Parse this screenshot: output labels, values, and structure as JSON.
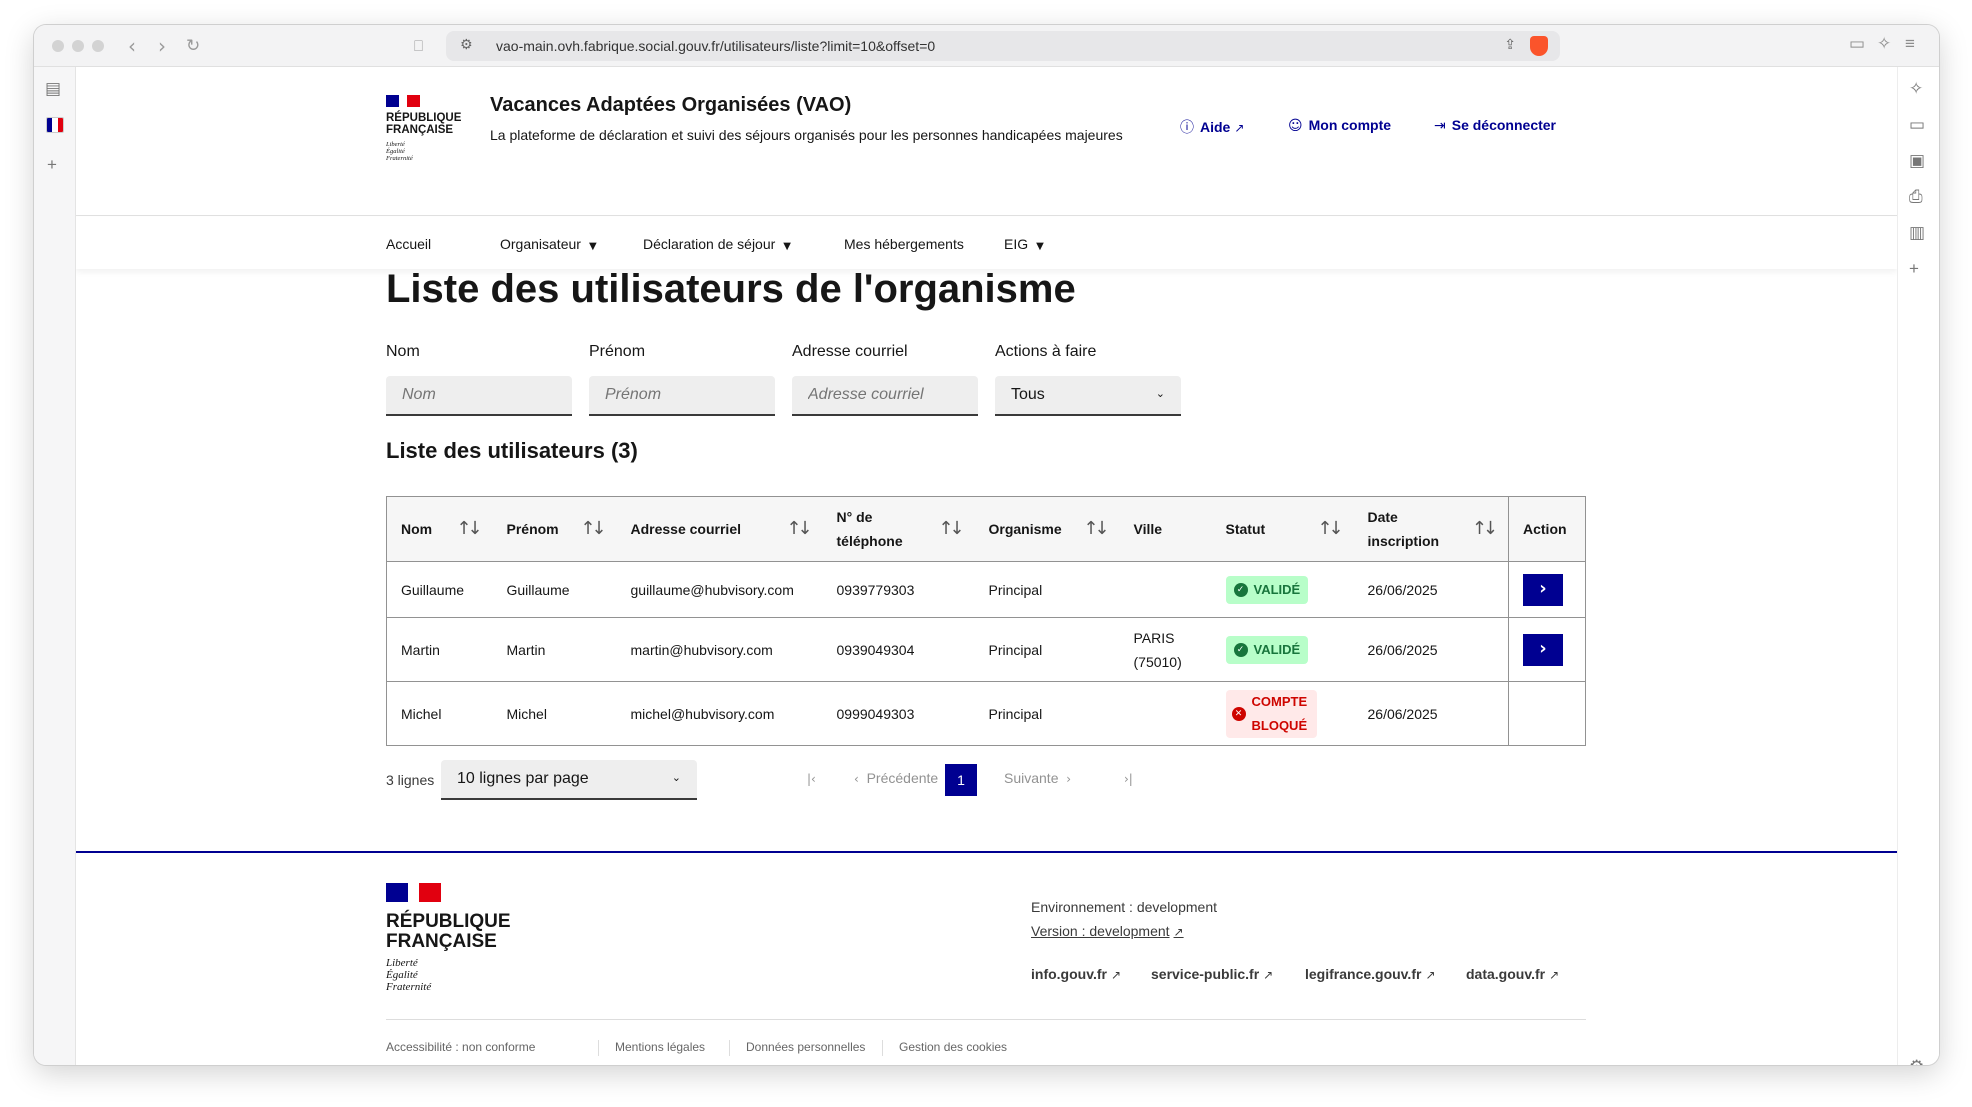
{
  "browser": {
    "url": "vao-main.ovh.fabrique.social.gouv.fr/utilisateurs/liste?limit=10&offset=0"
  },
  "header": {
    "rf_label_line1": "RÉPUBLIQUE",
    "rf_label_line2": "FRANÇAISE",
    "rf_motto_line1": "Liberté",
    "rf_motto_line2": "Égalité",
    "rf_motto_line3": "Fraternité",
    "title": "Vacances Adaptées Organisées (VAO)",
    "tagline": "La plateforme de déclaration et suivi des séjours organisés pour les personnes handicapées majeures",
    "help": "Aide",
    "account": "Mon compte",
    "logout": "Se déconnecter"
  },
  "nav": {
    "home": "Accueil",
    "organizer": "Organisateur",
    "declaration": "Déclaration de séjour",
    "housing": "Mes hébergements",
    "eig": "EIG"
  },
  "page": {
    "title": "Liste des utilisateurs de l'organisme"
  },
  "filters": {
    "nom_label": "Nom",
    "nom_placeholder": "Nom",
    "prenom_label": "Prénom",
    "prenom_placeholder": "Prénom",
    "email_label": "Adresse courriel",
    "email_placeholder": "Adresse courriel",
    "actions_label": "Actions à faire",
    "actions_value": "Tous"
  },
  "table": {
    "title": "Liste des utilisateurs (3)",
    "headers": {
      "nom": "Nom",
      "prenom": "Prénom",
      "email": "Adresse courriel",
      "phone_1": "N° de",
      "phone_2": "téléphone",
      "organisme": "Organisme",
      "ville": "Ville",
      "statut": "Statut",
      "date_1": "Date",
      "date_2": "inscription",
      "action": "Action"
    },
    "rows": [
      {
        "nom": "Guillaume",
        "prenom": "Guillaume",
        "email": "guillaume@hubvisory.com",
        "phone": "0939779303",
        "organisme": "Principal",
        "ville_1": "",
        "ville_2": "",
        "statut_1": "VALIDÉ",
        "statut_2": "",
        "date": "26/06/2025"
      },
      {
        "nom": "Martin",
        "prenom": "Martin",
        "email": "martin@hubvisory.com",
        "phone": "0939049304",
        "organisme": "Principal",
        "ville_1": "PARIS",
        "ville_2": "(75010)",
        "statut_1": "VALIDÉ",
        "statut_2": "",
        "date": "26/06/2025"
      },
      {
        "nom": "Michel",
        "prenom": "Michel",
        "email": "michel@hubvisory.com",
        "phone": "0999049303",
        "organisme": "Principal",
        "ville_1": "",
        "ville_2": "",
        "statut_1": "COMPTE",
        "statut_2": "BLOQUÉ",
        "date": "26/06/2025"
      }
    ]
  },
  "pagination": {
    "count": "3 lignes",
    "per_page": "10 lignes par page",
    "previous": "Précédente",
    "current": "1",
    "next": "Suivante"
  },
  "footer": {
    "rf_label_line1": "RÉPUBLIQUE",
    "rf_label_line2": "FRANÇAISE",
    "rf_motto_line1": "Liberté",
    "rf_motto_line2": "Égalité",
    "rf_motto_line3": "Fraternité",
    "environment": "Environnement : development",
    "version": "Version : development",
    "links": [
      "info.gouv.fr",
      "service-public.fr",
      "legifrance.gouv.fr",
      "data.gouv.fr"
    ],
    "bottom_links": [
      "Accessibilité : non conforme",
      "Mentions légales",
      "Données personnelles",
      "Gestion des cookies"
    ]
  },
  "colors": {
    "primary_blue": "#000091",
    "marianne_red": "#e1000f",
    "success": "#18753c",
    "error": "#ce0500"
  }
}
